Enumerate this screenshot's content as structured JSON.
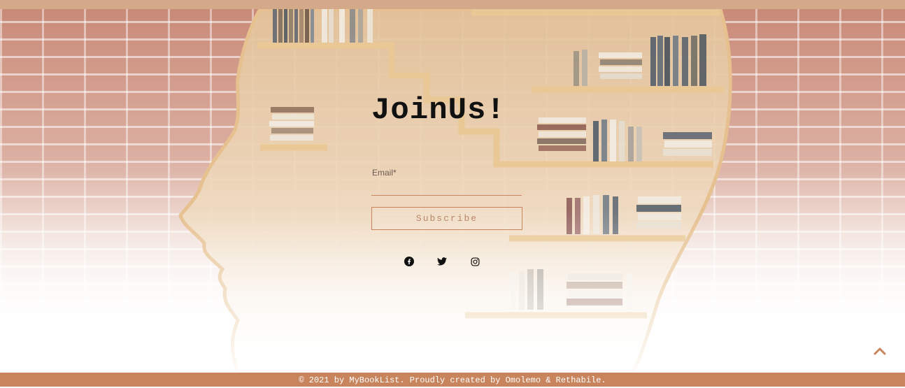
{
  "hero": {
    "title": "JoinUs!",
    "email_label": "Email*",
    "email_value": "",
    "subscribe_label": "Subscribe"
  },
  "social": {
    "icons": [
      "facebook-icon",
      "twitter-icon",
      "instagram-icon"
    ]
  },
  "back_to_top": {
    "icon": "chevron-up-icon"
  },
  "footer": {
    "text": "© 2021 by MyBookList. Proudly created by Omolemo & Rethabile."
  },
  "colors": {
    "top_bar": "#d4a98a",
    "accent": "#c8845c",
    "title": "#111111"
  }
}
